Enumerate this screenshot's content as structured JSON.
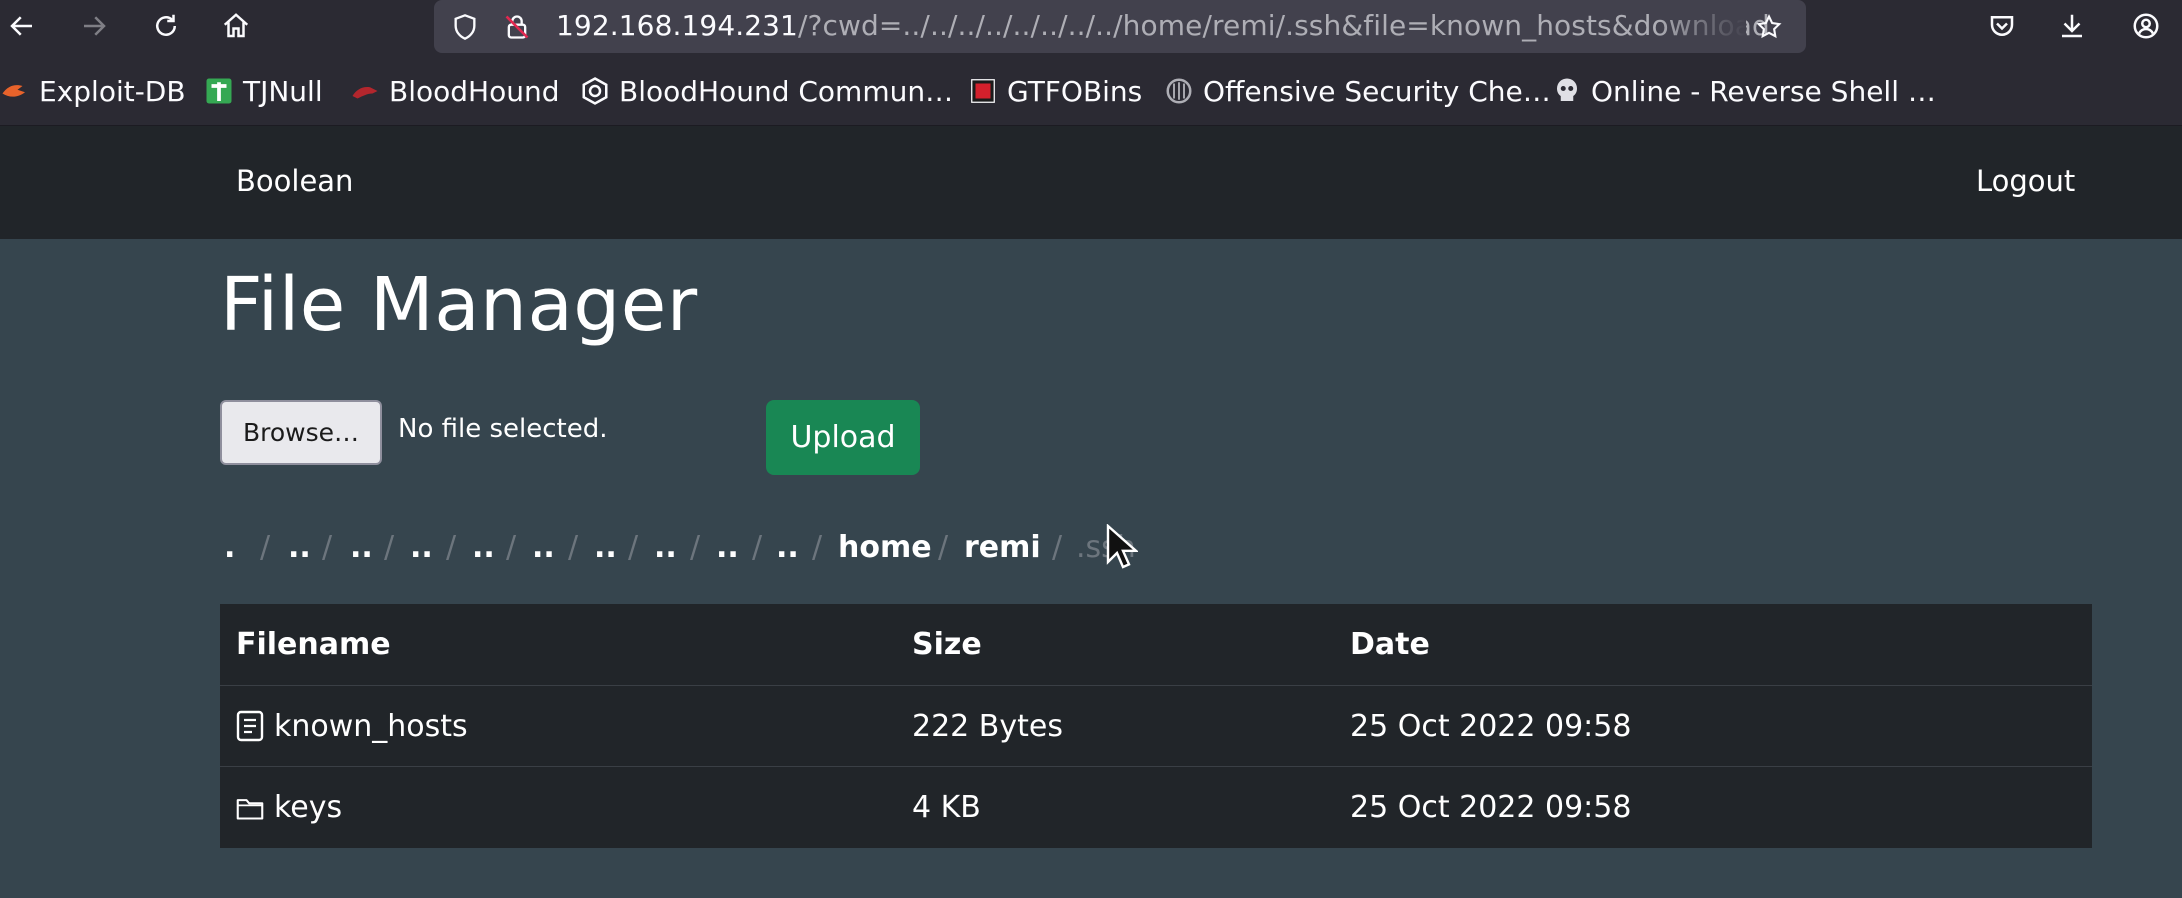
{
  "browser": {
    "url_host": "192.168.194.231",
    "url_rest": "/?cwd=../../../../../../../../home/remi/.ssh&file=known_hosts&download",
    "bookmarks": [
      {
        "label": "Exploit-DB"
      },
      {
        "label": "TJNull"
      },
      {
        "label": "BloodHound"
      },
      {
        "label": "BloodHound Commun…"
      },
      {
        "label": "GTFOBins"
      },
      {
        "label": "Offensive Security Che…"
      },
      {
        "label": "Online - Reverse Shell …"
      }
    ]
  },
  "navbar": {
    "brand": "Boolean",
    "logout": "Logout"
  },
  "page": {
    "title": "File Manager",
    "browse_label": "Browse…",
    "no_file_text": "No file selected.",
    "upload_label": "Upload"
  },
  "breadcrumb": {
    "items": [
      ".",
      "..",
      "..",
      "..",
      "..",
      "..",
      "..",
      "..",
      "..",
      "..",
      "home",
      "remi",
      ".ssh"
    ],
    "separator": "/"
  },
  "table": {
    "headers": {
      "filename": "Filename",
      "size": "Size",
      "date": "Date"
    },
    "rows": [
      {
        "name": "known_hosts",
        "size": "222 Bytes",
        "date": "25 Oct 2022 09:58",
        "icon": "file-text-icon"
      },
      {
        "name": "keys",
        "size": "4 KB",
        "date": "25 Oct 2022 09:58",
        "icon": "folder-icon"
      }
    ]
  }
}
